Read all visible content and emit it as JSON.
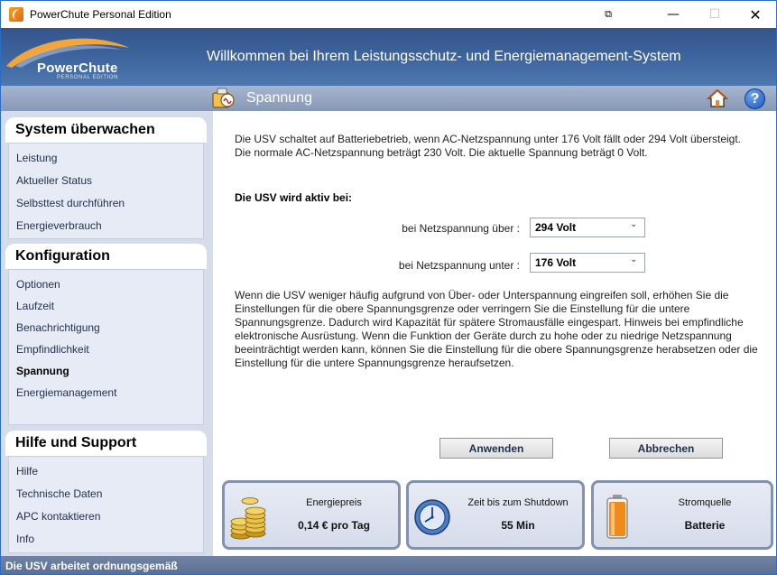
{
  "window": {
    "title": "PowerChute Personal Edition"
  },
  "header": {
    "logo_text": "PowerChute",
    "logo_sub": "PERSONAL EDITION",
    "title": "Willkommen bei Ihrem Leistungsschutz- und Energiemanagement-System"
  },
  "page": {
    "title": "Spannung"
  },
  "sidebar": {
    "sections": [
      {
        "title": "System überwachen",
        "items": [
          "Leistung",
          "Aktueller Status",
          "Selbsttest durchführen",
          "Energieverbrauch"
        ]
      },
      {
        "title": "Konfiguration",
        "items": [
          "Optionen",
          "Laufzeit",
          "Benachrichtigung",
          "Empfindlichkeit",
          "Spannung",
          "Energiemanagement"
        ]
      },
      {
        "title": "Hilfe und Support",
        "items": [
          "Hilfe",
          "Technische Daten",
          "APC kontaktieren",
          "Info"
        ]
      }
    ],
    "active_item": "Spannung"
  },
  "content": {
    "intro": "Die USV schaltet auf Batteriebetrieb, wenn AC-Netzspannung unter 176 Volt fällt oder 294 Volt übersteigt. Die normale AC-Netzspannung beträgt 230 Volt. Die aktuelle Spannung beträgt 0 Volt.",
    "active_heading": "Die USV wird aktiv bei:",
    "upper_label": "bei Netzspannung über :",
    "upper_value": "294 Volt",
    "lower_label": "bei Netzspannung unter :",
    "lower_value": "176 Volt",
    "explanation": "Wenn die USV weniger häufig aufgrund von Über- oder Unterspannung eingreifen soll, erhöhen Sie die Einstellungen für die obere Spannungsgrenze oder verringern Sie die Einstellung für die untere Spannungsgrenze. Dadurch wird Kapazität für spätere Stromausfälle eingespart. Hinweis bei empfindliche elektronische Ausrüstung. Wenn die Funktion der Geräte durch zu hohe oder zu niedrige Netzspannung beeinträchtigt werden kann, können Sie die Einstellung für die obere Spannungsgrenze herabsetzen oder die Einstellung für die untere Spannungsgrenze heraufsetzen.",
    "apply_label": "Anwenden",
    "cancel_label": "Abbrechen"
  },
  "cards": [
    {
      "label": "Energiepreis",
      "value": "0,14 € pro Tag",
      "icon": "coins-icon"
    },
    {
      "label": "Zeit bis zum Shutdown",
      "value": "55 Min",
      "icon": "clock-icon"
    },
    {
      "label": "Stromquelle",
      "value": "Batterie",
      "icon": "battery-icon"
    }
  ],
  "status": {
    "text": "Die USV arbeitet ordnungsgemäß"
  },
  "colors": {
    "header_blue": "#3f669f",
    "sidebar_bg": "#d5dcea",
    "statusbar": "#5c6f92"
  }
}
